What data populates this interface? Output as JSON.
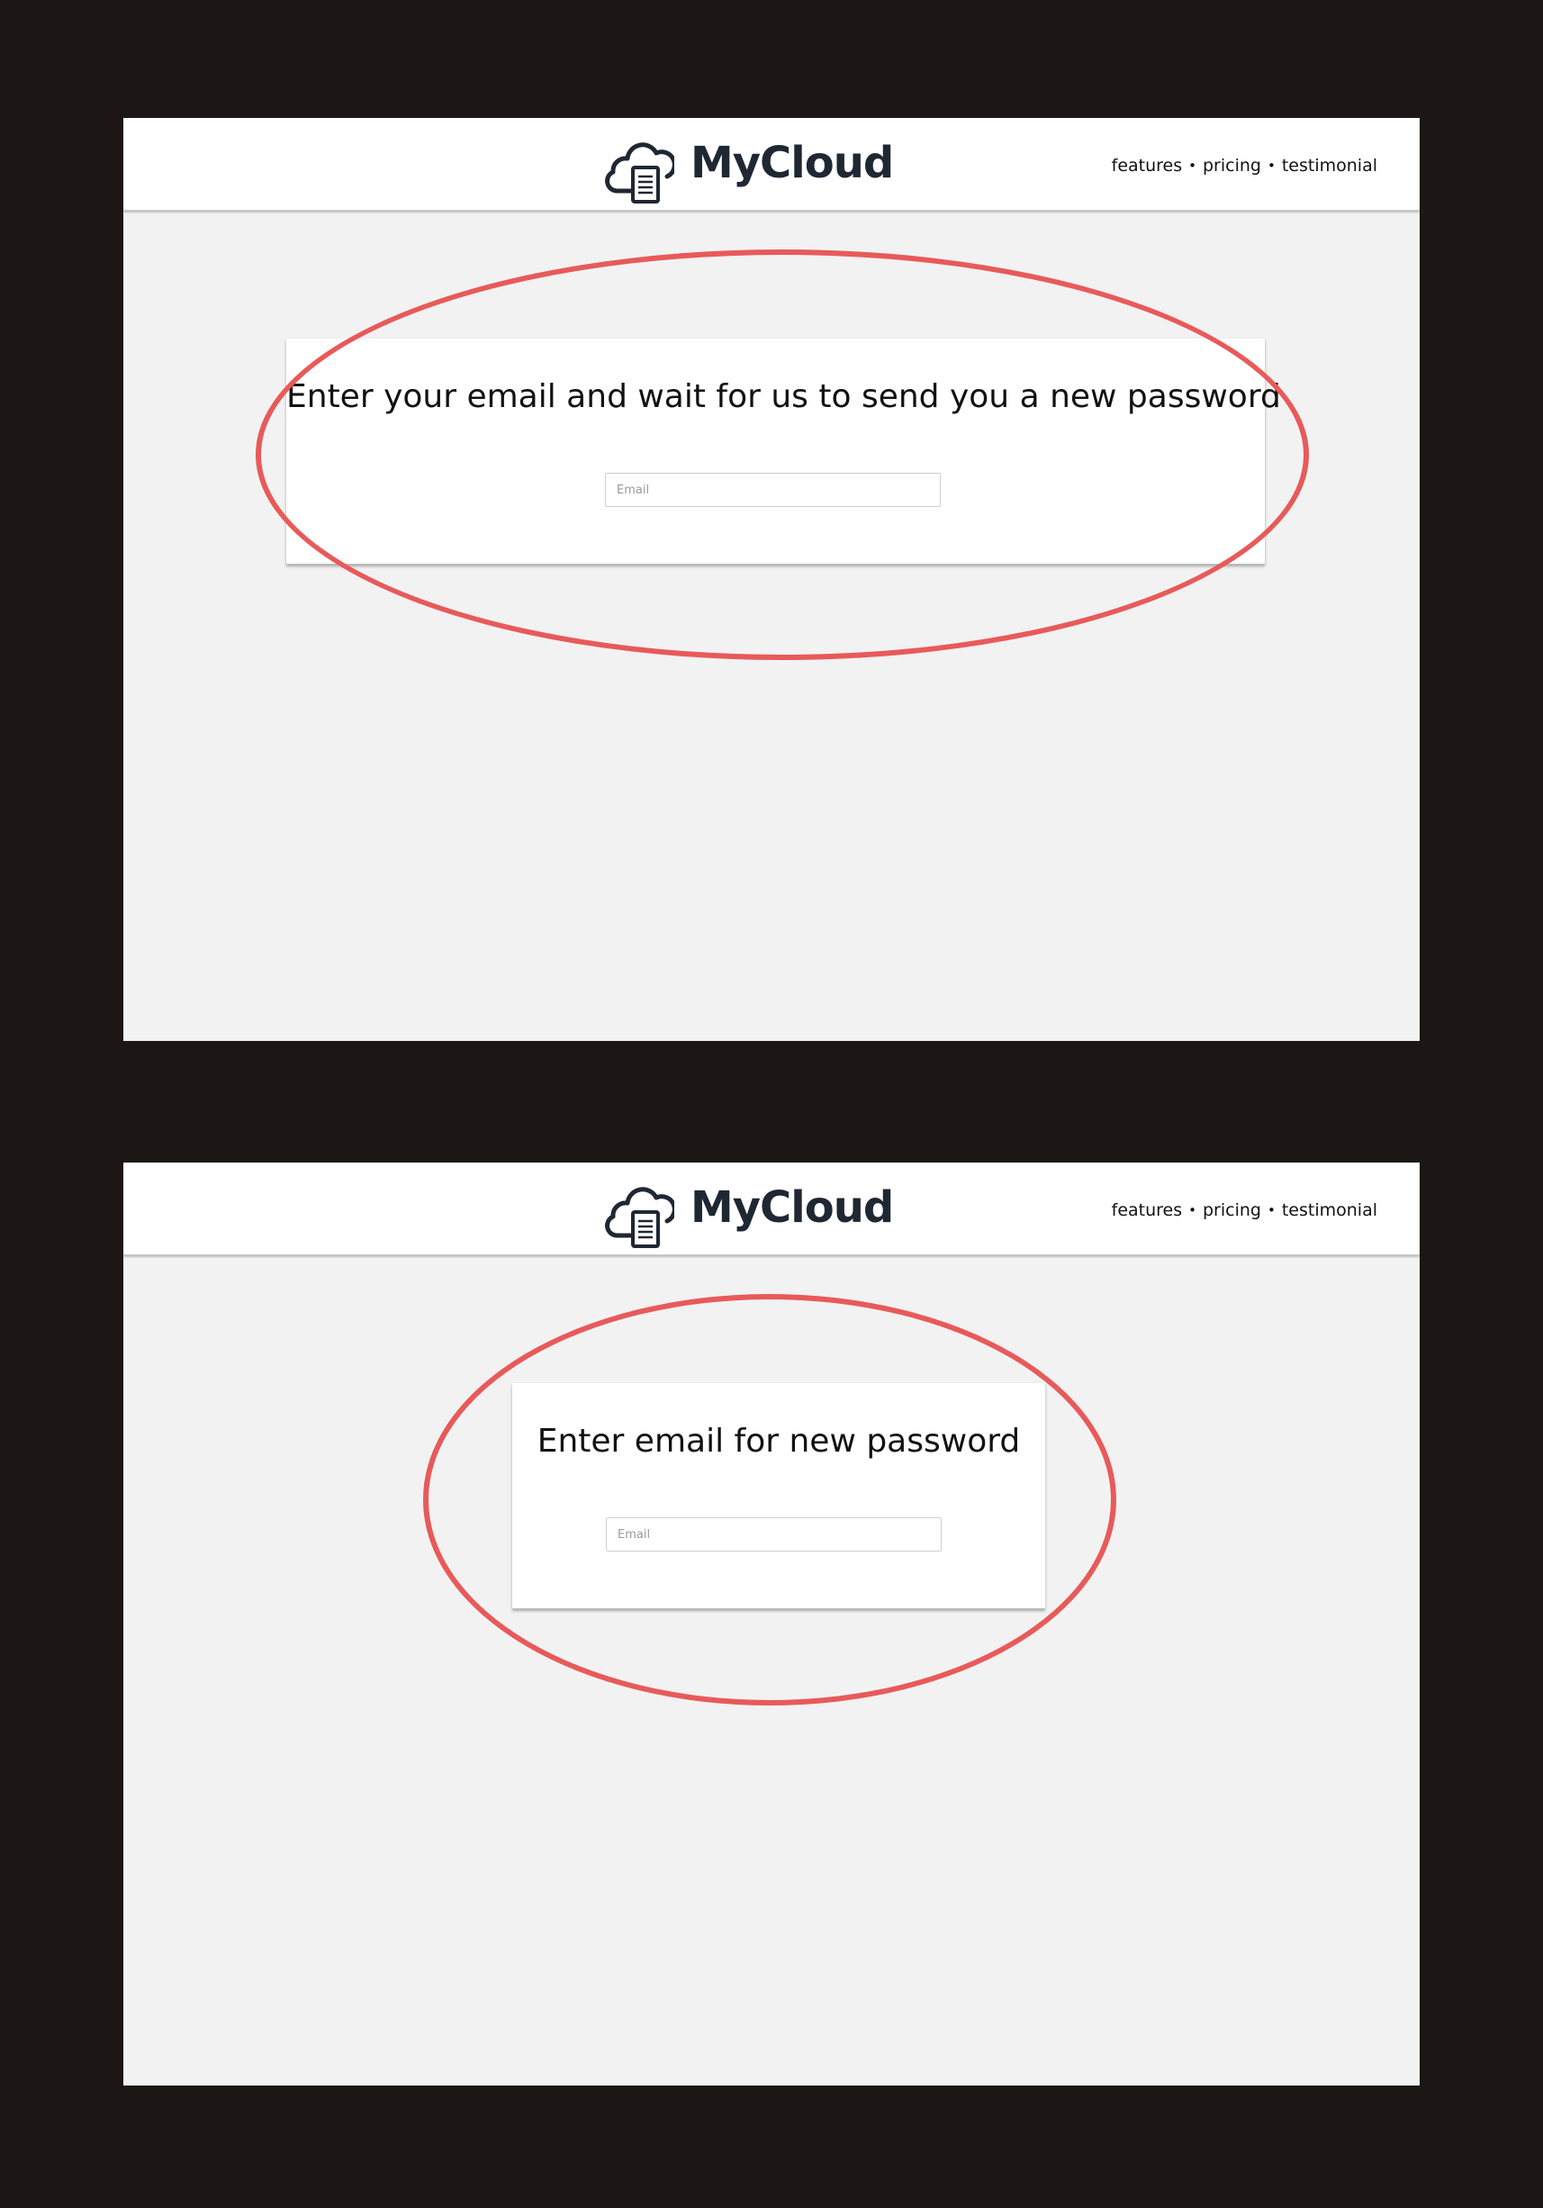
{
  "brand": {
    "name": "MyCloud",
    "logo_icon": "cloud-document-icon",
    "text_color": "#1f2733"
  },
  "nav": {
    "features": "features",
    "pricing": "pricing",
    "testimonial": "testimonial",
    "separator": "•"
  },
  "screens": [
    {
      "title": "Enter your email and wait for us to send you a new password",
      "email_placeholder": "Email",
      "email_value": ""
    },
    {
      "title": "Enter email for new password",
      "email_placeholder": "Email",
      "email_value": ""
    }
  ],
  "colors": {
    "backdrop": "#1c1714",
    "page_background": "#f2f2f2",
    "annotation": "#e85a5a"
  }
}
